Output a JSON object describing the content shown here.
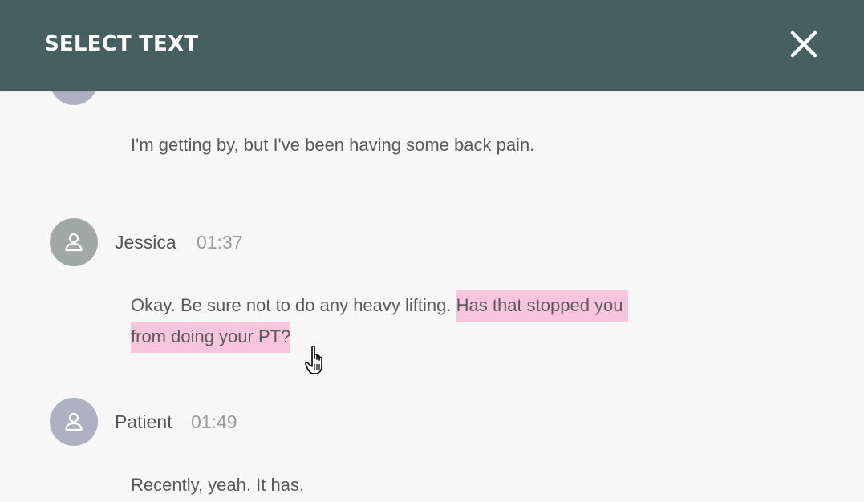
{
  "header": {
    "title": "SELECT TEXT",
    "close_icon": "close-icon"
  },
  "colors": {
    "header_bg": "#45605f",
    "background": "#f7f7f7",
    "highlight": "#f8c6dc",
    "avatar_jessica": "#9fa9a6",
    "avatar_patient": "#adb1c1"
  },
  "messages": [
    {
      "text": "I'm getting by, but I've been having some back pain."
    },
    {
      "speaker": "Jessica",
      "time": "01:37",
      "text_plain": "Okay. Be sure not to do any heavy lifting.",
      "text_highlighted_line1": "Has that stopped you",
      "text_highlighted_line2": "from doing your PT?"
    },
    {
      "speaker": "Patient",
      "time": "01:49",
      "text": "Recently, yeah. It has."
    }
  ]
}
